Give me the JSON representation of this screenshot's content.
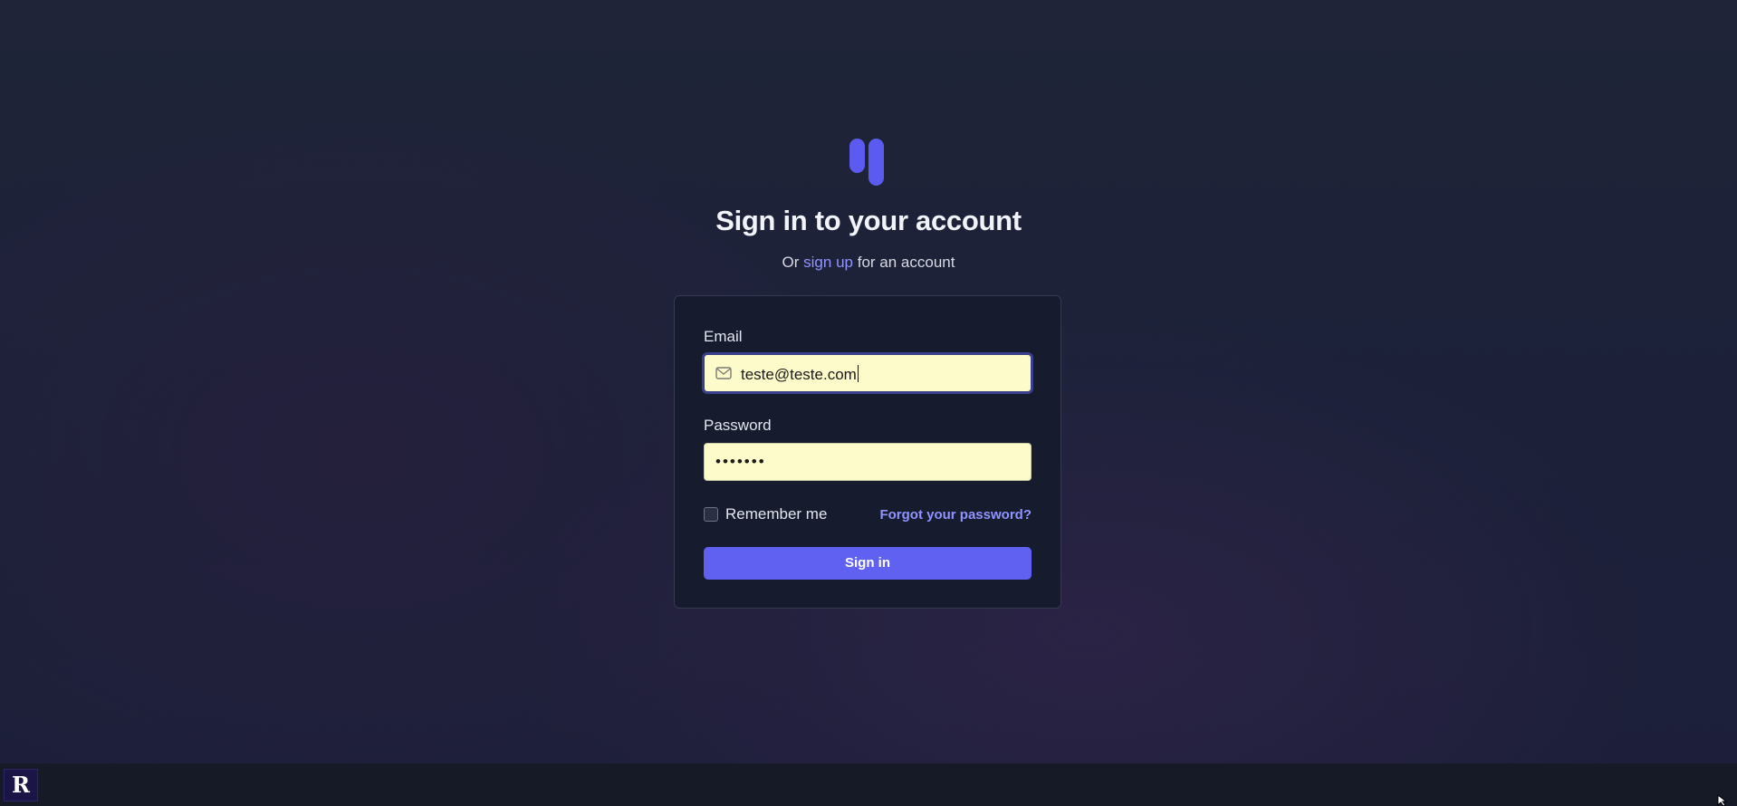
{
  "brand": {
    "logo_icon": "two-bars-logo",
    "accent_color": "#5b5bf2"
  },
  "heading": {
    "title": "Sign in to your account",
    "subtitle_prefix": "Or",
    "signup_link": "sign up",
    "subtitle_suffix": "for an account"
  },
  "form": {
    "email_label": "Email",
    "email_value": "teste@teste.com",
    "email_icon": "mail-icon",
    "password_label": "Password",
    "password_value": "•••••••",
    "remember_label": "Remember me",
    "remember_checked": false,
    "forgot_link": "Forgot your password?",
    "submit_label": "Sign in"
  },
  "taskbar": {
    "app_letter": "R"
  }
}
